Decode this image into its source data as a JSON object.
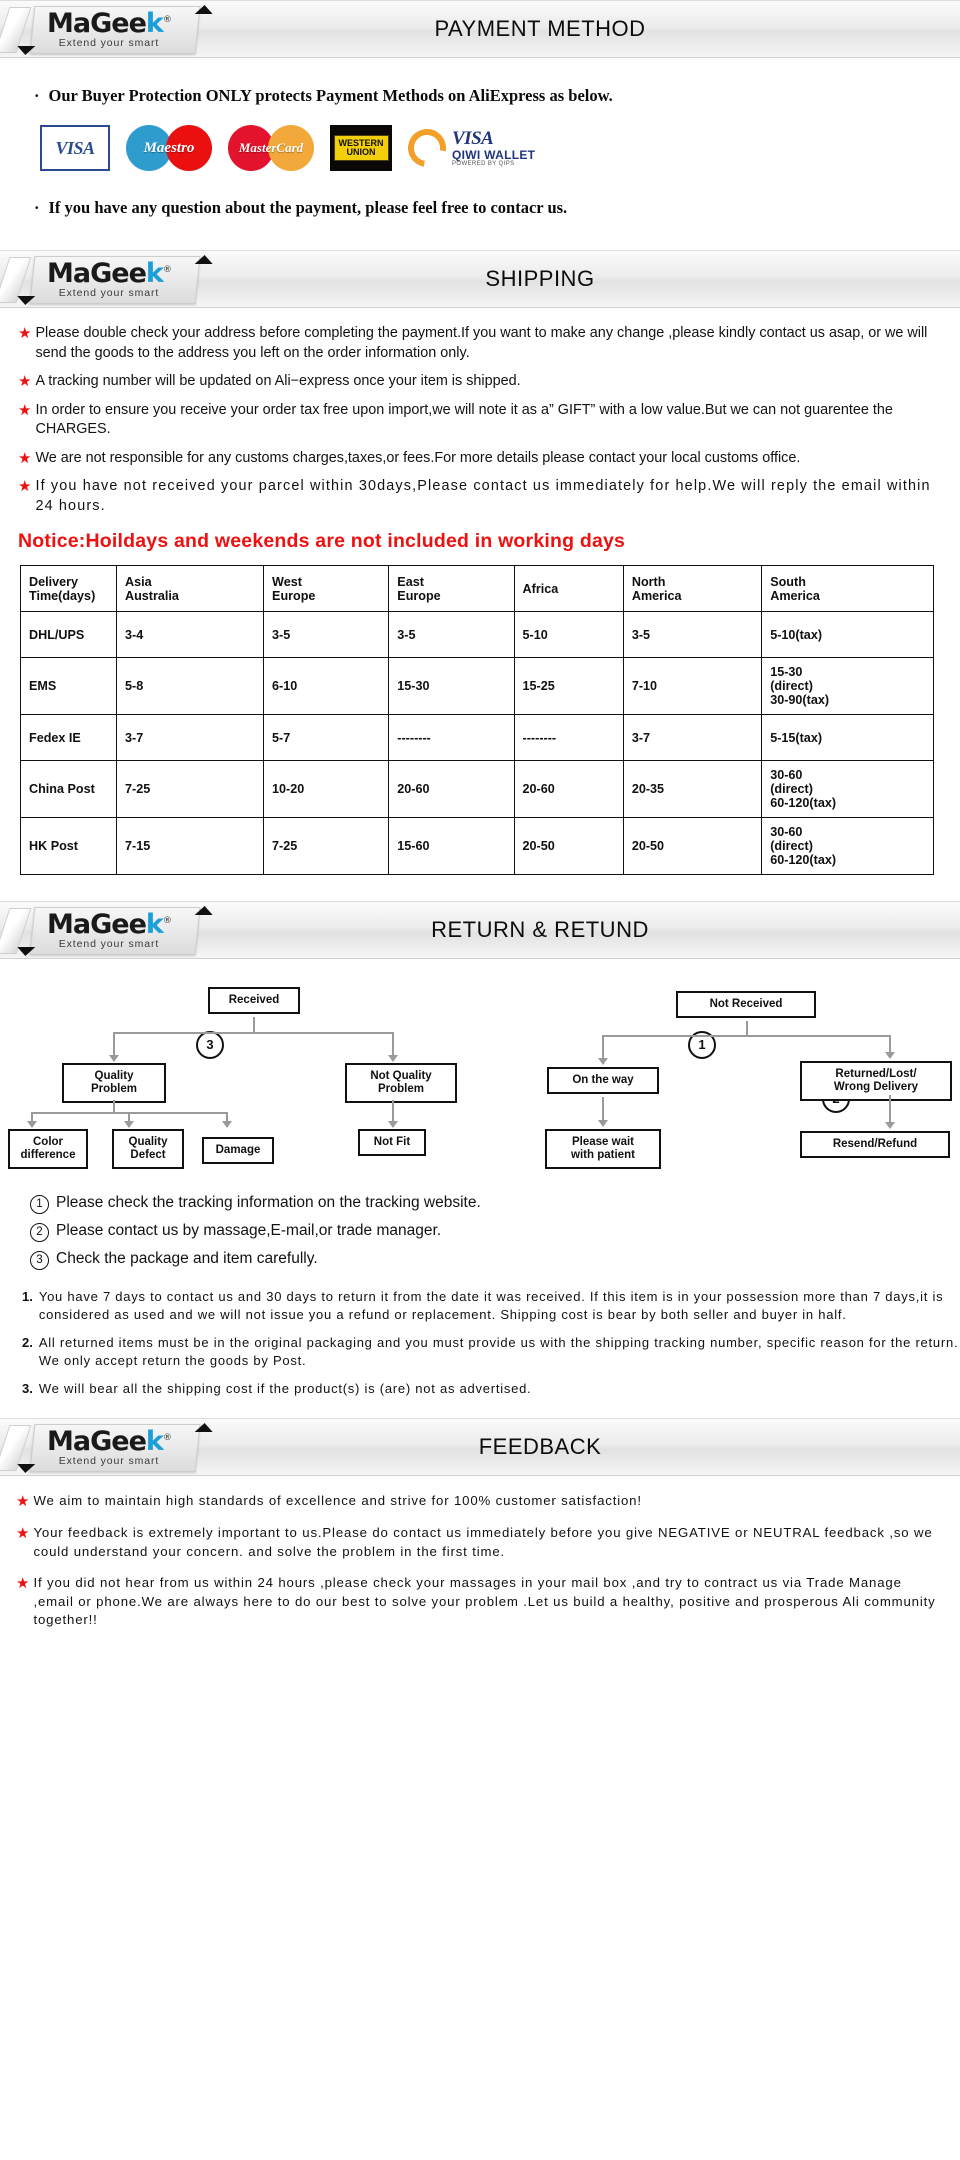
{
  "brand": {
    "name_pre": "MaGee",
    "name_k": "k",
    "registered": "®",
    "tagline": "Extend your smart"
  },
  "sections": {
    "payment": {
      "banner_title": "PAYMENT METHOD",
      "intro": "Our Buyer Protection ONLY protects Payment Methods on AliExpress as below.",
      "bullet_dot": "·",
      "logos": [
        {
          "name": "visa-logo",
          "label": "VISA"
        },
        {
          "name": "maestro-logo",
          "label": "Maestro"
        },
        {
          "name": "mastercard-logo",
          "label": "MasterCard"
        },
        {
          "name": "western-union-logo",
          "line1": "WESTERN",
          "line2": "UNION"
        },
        {
          "name": "qiwi-wallet-logo",
          "visa": "VISA",
          "wallet": "QIWI WALLET",
          "powered": "POWERED BY QIPS"
        }
      ],
      "outro": "If you have any question about the payment, please feel free to contacr us."
    },
    "shipping": {
      "banner_title": "SHIPPING",
      "bullets": [
        "Please double check your address before completing the payment.If you want to make any change ,please kindly contact us asap, or we will send the goods to the address you left on the order information only.",
        "A tracking number will be updated on Ali−express once your item is shipped.",
        "In order to ensure you receive your order tax free upon import,we will note it as a” GIFT” with a low value.But we can not guarentee the CHARGES.",
        "We are not responsible for any customs charges,taxes,or fees.For more details please contact your local customs office.",
        "If you have not received your parcel within 30days,Please contact us immediately for help.We will reply the email within 24 hours."
      ],
      "spaced_bullet_index": 4,
      "notice": "Notice:Hoildays and weekends are not included in working days",
      "table": {
        "headers": [
          "Delivery\nTime(days)",
          "Asia\nAustralia",
          "West\nEurope",
          "East\nEurope",
          "Africa",
          "North\nAmerica",
          "South\nAmerica"
        ],
        "rows": [
          {
            "carrier": "DHL/UPS",
            "cells": [
              "3-4",
              "3-5",
              "3-5",
              "5-10",
              "3-5",
              "5-10(tax)"
            ]
          },
          {
            "carrier": "EMS",
            "cells": [
              "5-8",
              "6-10",
              "15-30",
              "15-25",
              "7-10",
              "15-30\n(direct)\n30-90(tax)"
            ]
          },
          {
            "carrier": "Fedex IE",
            "cells": [
              "3-7",
              "5-7",
              "--------",
              "--------",
              "3-7",
              "5-15(tax)"
            ]
          },
          {
            "carrier": "China Post",
            "cells": [
              "7-25",
              "10-20",
              "20-60",
              "20-60",
              "20-35",
              "30-60\n(direct)\n60-120(tax)"
            ]
          },
          {
            "carrier": "HK Post",
            "cells": [
              "7-15",
              "7-25",
              "15-60",
              "20-50",
              "20-50",
              "30-60\n(direct)\n60-120(tax)"
            ]
          }
        ]
      }
    },
    "return": {
      "banner_title": "RETURN & RETUND",
      "flow_left": {
        "root": "Received",
        "marker": "3",
        "branch_a": "Quality\nProblem",
        "branch_b": "Not Quality\nProblem",
        "leaf_a1": "Color\ndifference",
        "leaf_a2": "Quality\nDefect",
        "leaf_a3": "Damage",
        "leaf_b1": "Not Fit"
      },
      "flow_right": {
        "root": "Not  Received",
        "marker_1": "1",
        "marker_2": "2",
        "branch_a": "On the way",
        "branch_b": "Returned/Lost/\nWrong Delivery",
        "leaf_a": "Please wait\nwith patient",
        "leaf_b": "Resend/Refund"
      },
      "notes": [
        {
          "num": "1",
          "text": "Please check the tracking information on the tracking website."
        },
        {
          "num": "2",
          "text": "Please contact us by  massage,E-mail,or trade manager."
        },
        {
          "num": "3",
          "text": "Check the package and item carefully."
        }
      ],
      "terms": [
        {
          "num": "1.",
          "text": "You have 7 days to contact us and 30 days to return it from the date it was received. If this item is in your possession more than 7 days,it is considered as used and we will not issue you a refund or replacement. Shipping cost is bear by both seller and buyer in half."
        },
        {
          "num": "2.",
          "text": "All returned items must be in the original packaging and you must provide us with the shipping tracking number, specific reason for the return. We only accept return the goods by Post."
        },
        {
          "num": "3.",
          "text": "We will bear all the shipping cost if the product(s) is (are) not as advertised."
        }
      ]
    },
    "feedback": {
      "banner_title": "FEEDBACK",
      "items": [
        "We aim to maintain high standards of excellence and strive  for 100% customer satisfaction!",
        "Your feedback is extremely important to us.Please do contact us immediately before you give NEGATIVE or NEUTRAL feedback ,so  we could understand your concern. and solve the problem in the first time.",
        "If you did not hear from us within 24 hours ,please check your massages in your mail box ,and try to contract us via Trade Manage ,email or phone.We are always here to do our best to solve your problem .Let us build a healthy, positive and prosperous Ali community together!!"
      ]
    }
  },
  "colors": {
    "star_red": "#ee1111",
    "notice_red": "#ee1111",
    "logo_blue": "#1a9fd9"
  }
}
